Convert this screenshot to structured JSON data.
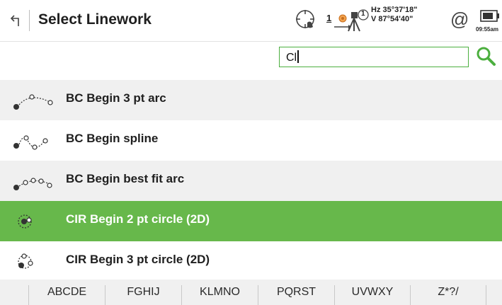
{
  "header": {
    "title": "Select Linework",
    "instrument_count": "1",
    "prism_number": "1",
    "hz_angle": "Hz 35°37'18\"",
    "v_angle": "V  87°54'40\"",
    "at_symbol": "@",
    "time": "09:55am"
  },
  "search": {
    "value": "Cl",
    "placeholder": ""
  },
  "list": {
    "items": [
      {
        "label": "BC Begin 3 pt arc",
        "icon": "three-point-arc-icon",
        "selected": false
      },
      {
        "label": "BC Begin spline",
        "icon": "spline-icon",
        "selected": false
      },
      {
        "label": "BC Begin best fit arc",
        "icon": "best-fit-arc-icon",
        "selected": false
      },
      {
        "label": "CIR Begin 2 pt circle (2D)",
        "icon": "two-point-circle-icon",
        "selected": true
      },
      {
        "label": "CIR Begin 3 pt circle (2D)",
        "icon": "three-point-circle-icon",
        "selected": false
      }
    ]
  },
  "alphabet": {
    "groups": [
      "ABCDE",
      "FGHIJ",
      "KLMNO",
      "PQRST",
      "UVWXY",
      "Z*?/"
    ]
  },
  "colors": {
    "selected_row": "#67b84b",
    "input_border": "#4caf3f",
    "alt_row": "#f0f0f0"
  }
}
